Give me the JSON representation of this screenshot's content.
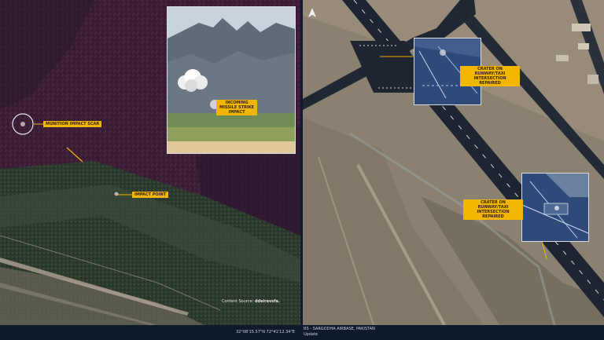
{
  "left_panel": {
    "labels": {
      "munition_impact": "Munition impact scar",
      "impact_point": "Impact point"
    },
    "inset_label": "Incoming missile strike impact",
    "credit": {
      "prefix": "Content Source:",
      "brand": "ddeiravsfa."
    }
  },
  "right_panel": {
    "labels": {
      "crater_intersection": "Crater on runway/taxi intersection repaired",
      "crater_runway": "Crater on runway/taxi intersection repaired"
    }
  },
  "bottom_bar": {
    "coordinates": "32°08'15.57\"N 72°41'12.34\"E",
    "location": "RS - SARGODHA AIRBASE, PAKISTAN",
    "sub": "Update"
  },
  "colors": {
    "accent_label": "#f2b600",
    "bar_background": "#0d1a2b"
  },
  "icons": [
    "north-arrow-icon",
    "impact-circle-icon"
  ]
}
